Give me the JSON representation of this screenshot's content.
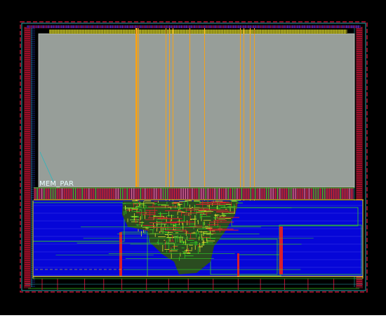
{
  "layout": {
    "label": "MEM_PAR",
    "colors": {
      "background": "#000000",
      "memory_block": "#979e99",
      "core_fill": "#0606d8",
      "pad_ring": "#c11030",
      "metal_yellow": "#e6e22a",
      "metal_green": "#33cc22",
      "metal_orange": "#f2a21c",
      "cell_red": "#d81e2c",
      "outline_cyan": "#28b0b8"
    }
  }
}
